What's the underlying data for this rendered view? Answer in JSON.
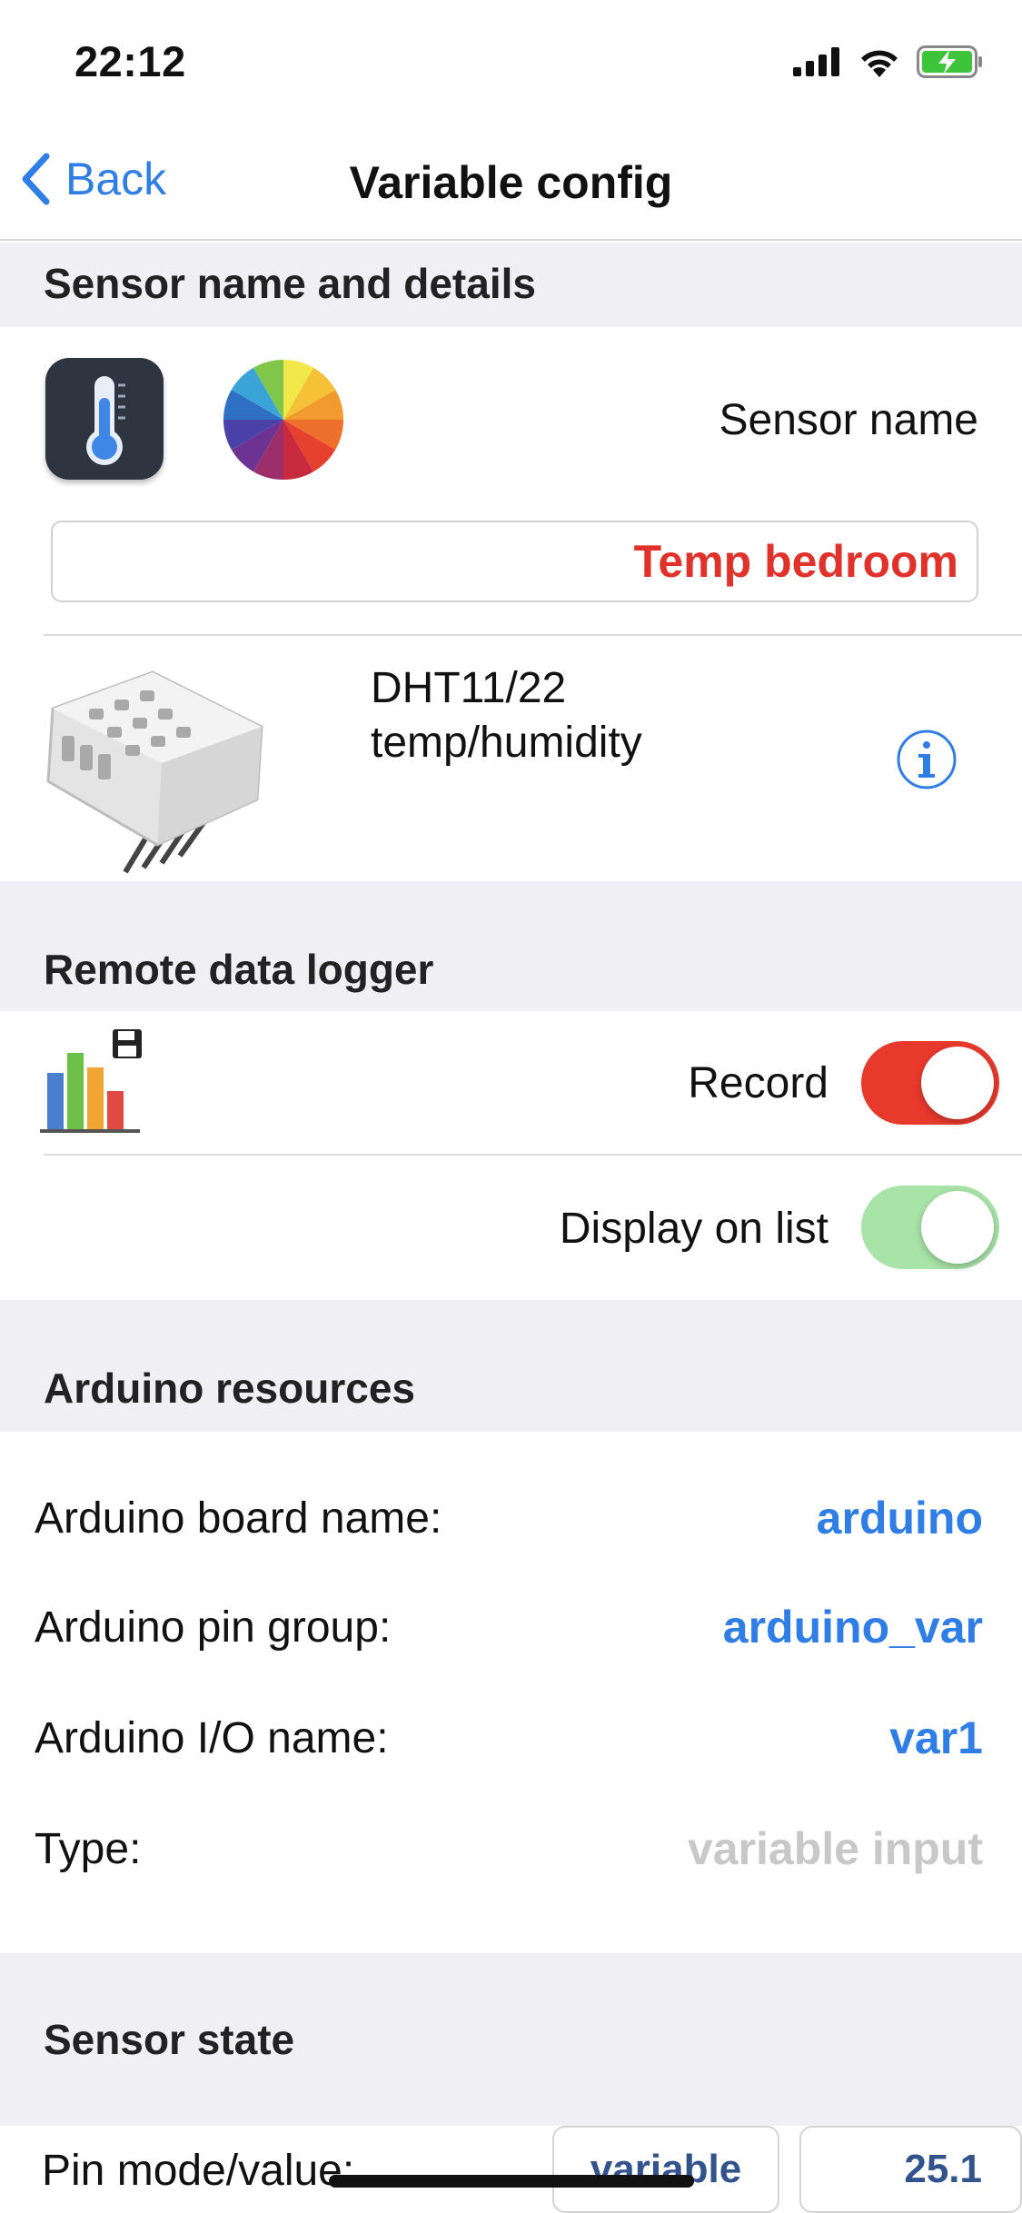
{
  "status_bar": {
    "time": "22:12"
  },
  "nav": {
    "back_label": "Back",
    "title": "Variable config"
  },
  "sensor_section": {
    "header": "Sensor name and details",
    "name_label": "Sensor name",
    "name_value": "Temp bedroom",
    "sensor_model": "DHT11/22",
    "sensor_kind": "temp/humidity"
  },
  "logger_section": {
    "header": "Remote data logger",
    "record_label": "Record",
    "record_on": true,
    "display_label": "Display on  list",
    "display_on": true
  },
  "arduino_section": {
    "header": "Arduino resources",
    "rows": [
      {
        "label": "Arduino board name:",
        "value": "arduino"
      },
      {
        "label": "Arduino pin group:",
        "value": "arduino_var"
      },
      {
        "label": "Arduino I/O name:",
        "value": "var1"
      },
      {
        "label": "Type:",
        "value": "variable input"
      }
    ]
  },
  "state_section": {
    "header": "Sensor state",
    "pin_label": "Pin mode/value:",
    "pin_mode": "variable",
    "pin_value": "25.1"
  },
  "colors": {
    "accent": "#2f7ee6",
    "name_red": "#e0312a",
    "toggle_red": "#e8392d",
    "toggle_green_light": "#a8e3a8",
    "section_bg": "#efeff4"
  }
}
